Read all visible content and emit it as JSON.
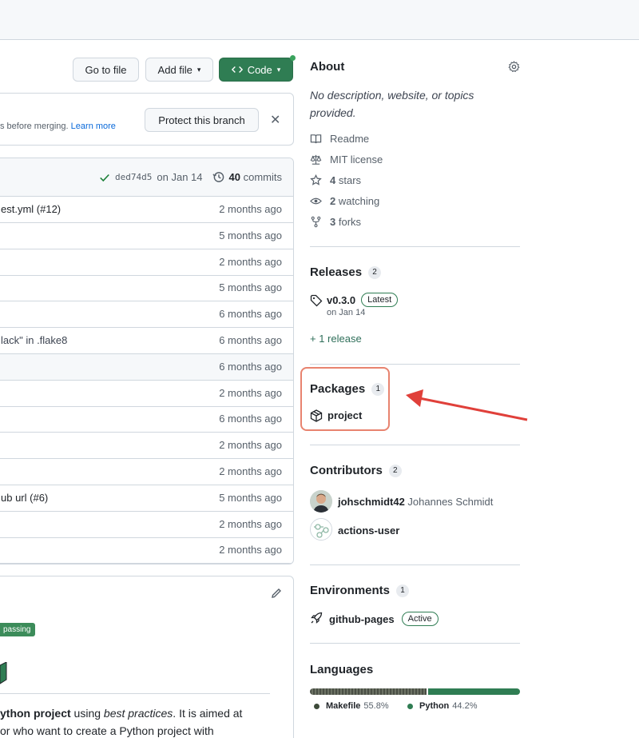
{
  "toolbar": {
    "go_to_file": "Go to file",
    "add_file": "Add file",
    "code": "Code"
  },
  "branch_protection": {
    "text_tail": "s before merging.",
    "learn_more": "Learn more",
    "protect_button": "Protect this branch"
  },
  "latest_commit": {
    "sha": "ded74d5",
    "date": "on Jan 14",
    "commit_count": "40",
    "commits_label": "commits"
  },
  "files": [
    {
      "message": "est.yml (#12)",
      "time": "2 months ago",
      "link": true
    },
    {
      "message": "",
      "time": "5 months ago"
    },
    {
      "message": "",
      "time": "2 months ago"
    },
    {
      "message": "",
      "time": "5 months ago"
    },
    {
      "message": "",
      "time": "6 months ago"
    },
    {
      "message": "lack\" in .flake8",
      "time": "6 months ago"
    },
    {
      "message": "",
      "time": "6 months ago"
    },
    {
      "message": "",
      "time": "2 months ago"
    },
    {
      "message": "",
      "time": "6 months ago"
    },
    {
      "message": "",
      "time": "2 months ago"
    },
    {
      "message": "",
      "time": "2 months ago"
    },
    {
      "message": "ub url (#6)",
      "time": "5 months ago",
      "link": true
    },
    {
      "message": "",
      "time": "2 months ago"
    },
    {
      "message": "",
      "time": "2 months ago"
    }
  ],
  "readme": {
    "badge": "passing",
    "line1_bold": "ython project",
    "line1_mid": " using ",
    "line1_italic": "best practices",
    "line1_end": ". It is aimed at",
    "line2": "or who want to create a Python project with"
  },
  "about": {
    "title": "About",
    "description": "No description, website, or topics provided.",
    "readme": "Readme",
    "license": "MIT license",
    "stars_count": "4",
    "stars_label": "stars",
    "watching_count": "2",
    "watching_label": "watching",
    "forks_count": "3",
    "forks_label": "forks"
  },
  "releases": {
    "title": "Releases",
    "count": "2",
    "version": "v0.3.0",
    "latest_label": "Latest",
    "date": "on Jan 14",
    "more": "+ 1 release"
  },
  "packages": {
    "title": "Packages",
    "count": "1",
    "item": "project"
  },
  "contributors": {
    "title": "Contributors",
    "count": "2",
    "people": [
      {
        "login": "johschmidt42",
        "name": "Johannes Schmidt"
      },
      {
        "login": "actions-user",
        "name": ""
      }
    ]
  },
  "environments": {
    "title": "Environments",
    "count": "1",
    "item": "github-pages",
    "status": "Active"
  },
  "languages": {
    "title": "Languages",
    "items": [
      {
        "name": "Makefile",
        "percent": "55.8%",
        "fraction": 0.558,
        "color": "#427819"
      },
      {
        "name": "Python",
        "percent": "44.2%",
        "fraction": 0.442,
        "color": "#3572A5"
      }
    ]
  },
  "colors": {
    "accent_green": "#2f7d53",
    "annotation_red": "#e0403a"
  }
}
